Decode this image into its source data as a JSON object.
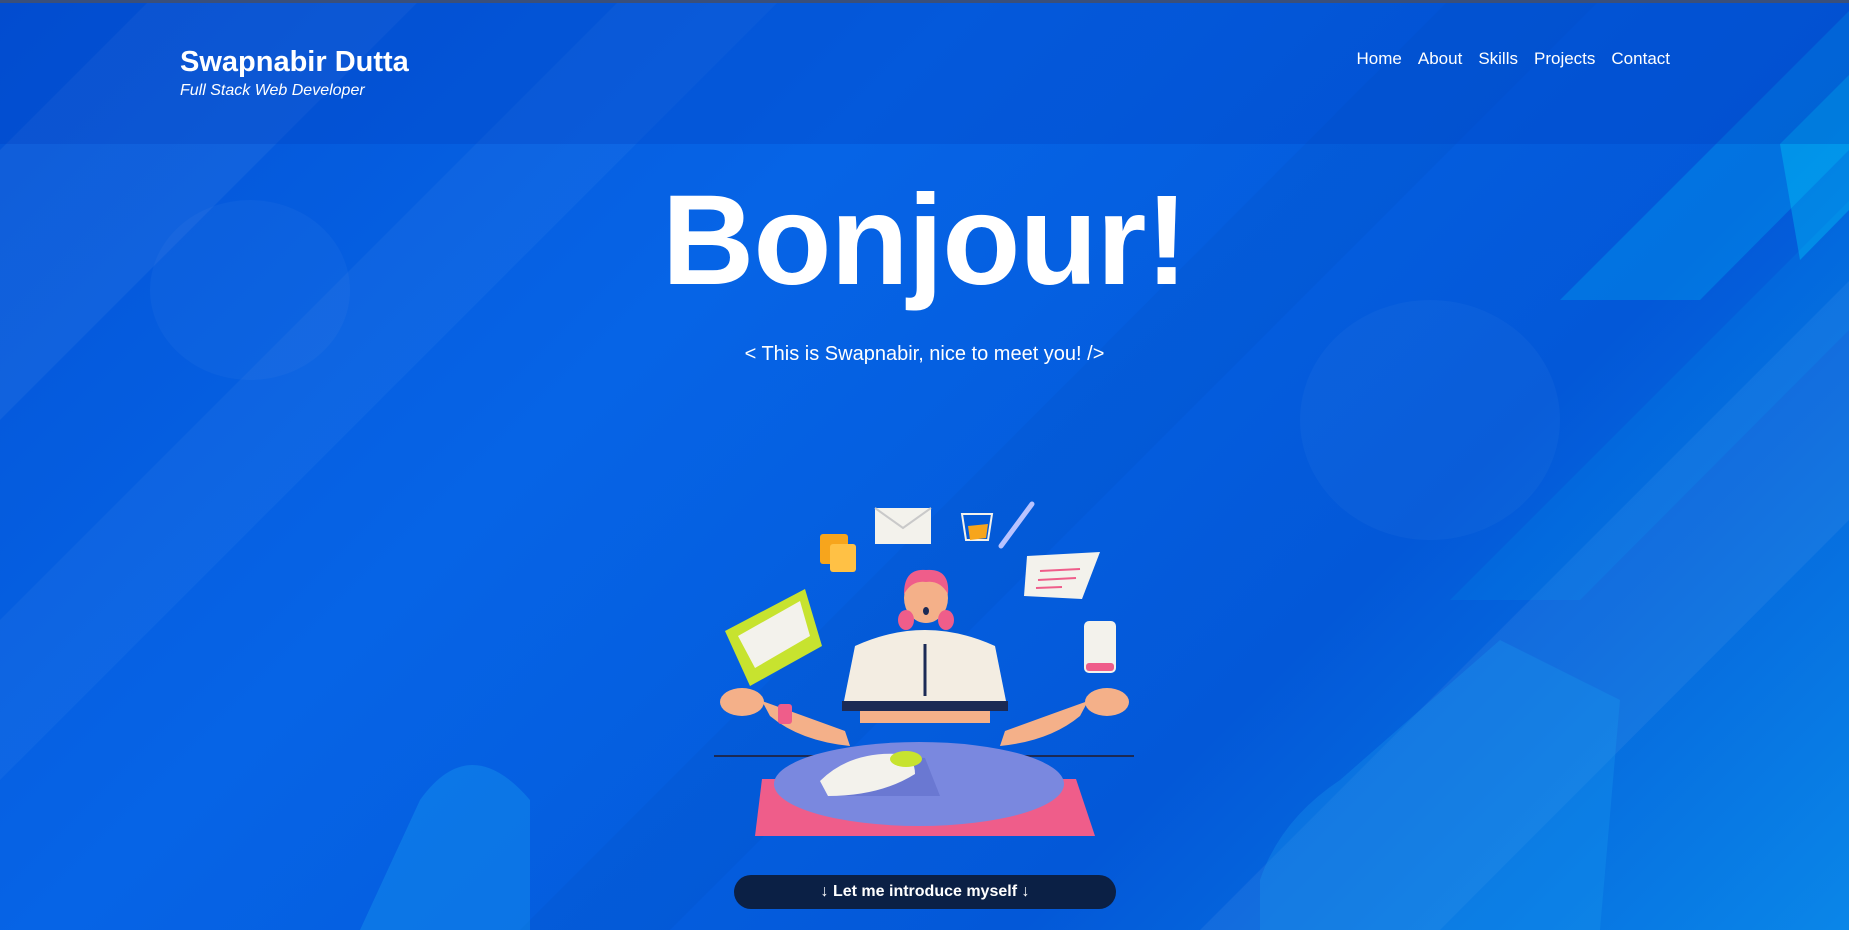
{
  "header": {
    "name": "Swapnabir Dutta",
    "subtitle": "Full Stack Web Developer",
    "nav": [
      "Home",
      "About",
      "Skills",
      "Projects",
      "Contact"
    ]
  },
  "hero": {
    "title": "Bonjour!",
    "subtitle": "< This is Swapnabir, nice to meet you! />",
    "illustration": "meditating-person-juggling-items-illustration",
    "cta_label": "↓ Let me introduce myself ↓"
  },
  "colors": {
    "background": "#0560e0",
    "header_overlay": "#003cbe",
    "button": "#0b2045",
    "text": "#ffffff"
  }
}
